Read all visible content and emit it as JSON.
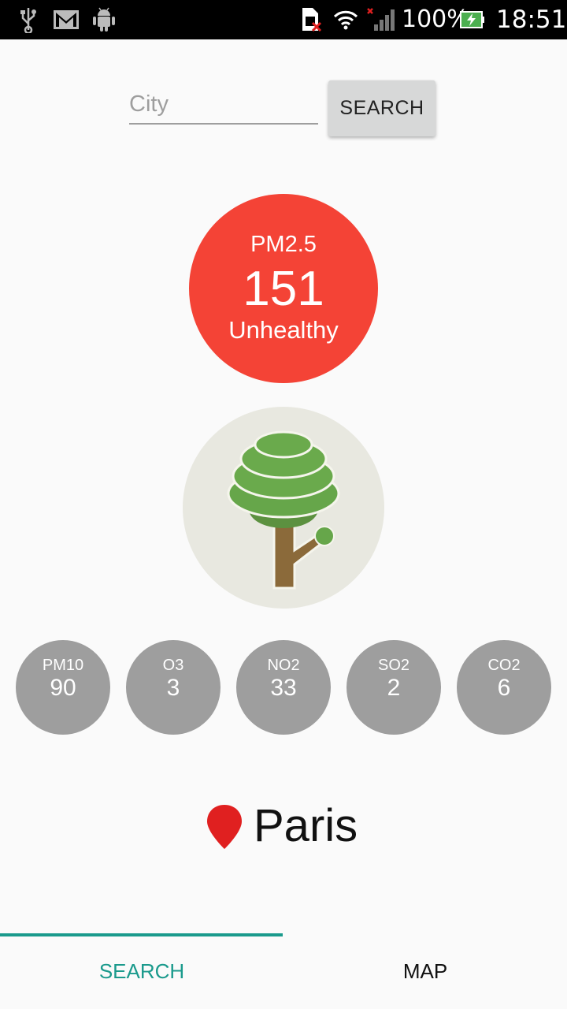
{
  "status_bar": {
    "icons": [
      "usb-icon",
      "gmail-icon",
      "android-debug-icon",
      "sim-error-icon",
      "wifi-icon",
      "signal-icon",
      "battery-icon"
    ],
    "battery": "100%",
    "time": "18:51"
  },
  "search": {
    "placeholder": "City",
    "value": "",
    "button_label": "SEARCH"
  },
  "main_reading": {
    "label": "PM2.5",
    "value": "151",
    "status": "Unhealthy",
    "color": "#f44336"
  },
  "illustration": {
    "icon": "tree-icon"
  },
  "pollutants": [
    {
      "name": "PM10",
      "value": "90"
    },
    {
      "name": "O3",
      "value": "3"
    },
    {
      "name": "NO2",
      "value": "33"
    },
    {
      "name": "SO2",
      "value": "2"
    },
    {
      "name": "CO2",
      "value": "6"
    }
  ],
  "location": {
    "icon": "map-pin-icon",
    "city": "Paris"
  },
  "tabs": [
    {
      "label": "SEARCH",
      "active": true
    },
    {
      "label": "MAP",
      "active": false
    }
  ],
  "colors": {
    "accent": "#1a9a8c",
    "pollutant_bg": "#9e9e9e",
    "pin": "#e02020"
  }
}
